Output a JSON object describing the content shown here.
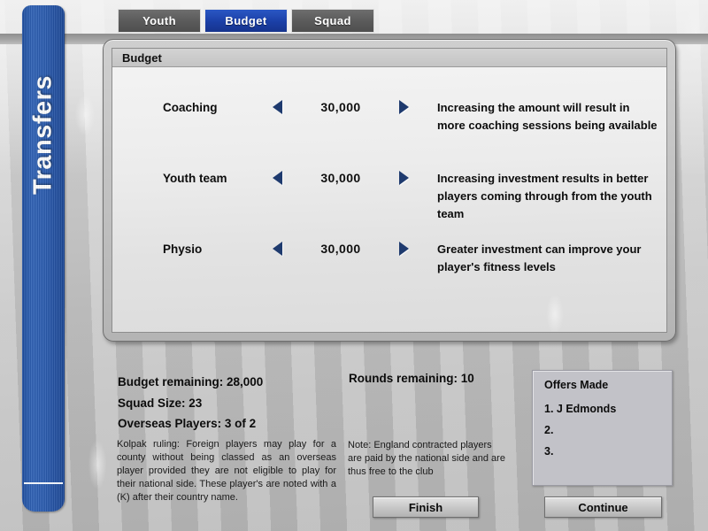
{
  "app": {
    "rail_label": "Transfers",
    "accent_color": "#1b3fa6",
    "rail_color": "#2a5bae"
  },
  "tabs": [
    {
      "label": "Youth",
      "active": false
    },
    {
      "label": "Budget",
      "active": true
    },
    {
      "label": "Squad",
      "active": false
    }
  ],
  "panel": {
    "title": "Budget",
    "rows": [
      {
        "name": "Coaching",
        "amount": "30,000",
        "description": "Increasing the amount will result in more coaching sessions being available",
        "decrease_icon": "triangle-left-icon",
        "increase_icon": "triangle-right-icon"
      },
      {
        "name": "Youth team",
        "amount": "30,000",
        "description": "Increasing investment results in better players coming through from the youth team",
        "decrease_icon": "triangle-left-icon",
        "increase_icon": "triangle-right-icon"
      },
      {
        "name": "Physio",
        "amount": "30,000",
        "description": "Greater investment can improve your player's fitness levels",
        "decrease_icon": "triangle-left-icon",
        "increase_icon": "triangle-right-icon"
      }
    ]
  },
  "stats": {
    "budget_remaining": "Budget remaining: 28,000",
    "squad_size": "Squad Size: 23",
    "overseas_players": "Overseas Players: 3 of 2",
    "rounds_remaining": "Rounds remaining: 10"
  },
  "notes": {
    "kolpak": "Kolpak ruling: Foreign players may play for a county without being classed as an overseas player provided they are not eligible to play for their national side.  These player's are noted with a (K) after their country name.",
    "england": "Note: England contracted players are paid by the national side and are thus free to the club"
  },
  "offers": {
    "title": "Offers Made",
    "items": [
      "1. J Edmonds",
      "2.",
      "3."
    ]
  },
  "buttons": {
    "finish": "Finish",
    "continue": "Continue"
  }
}
